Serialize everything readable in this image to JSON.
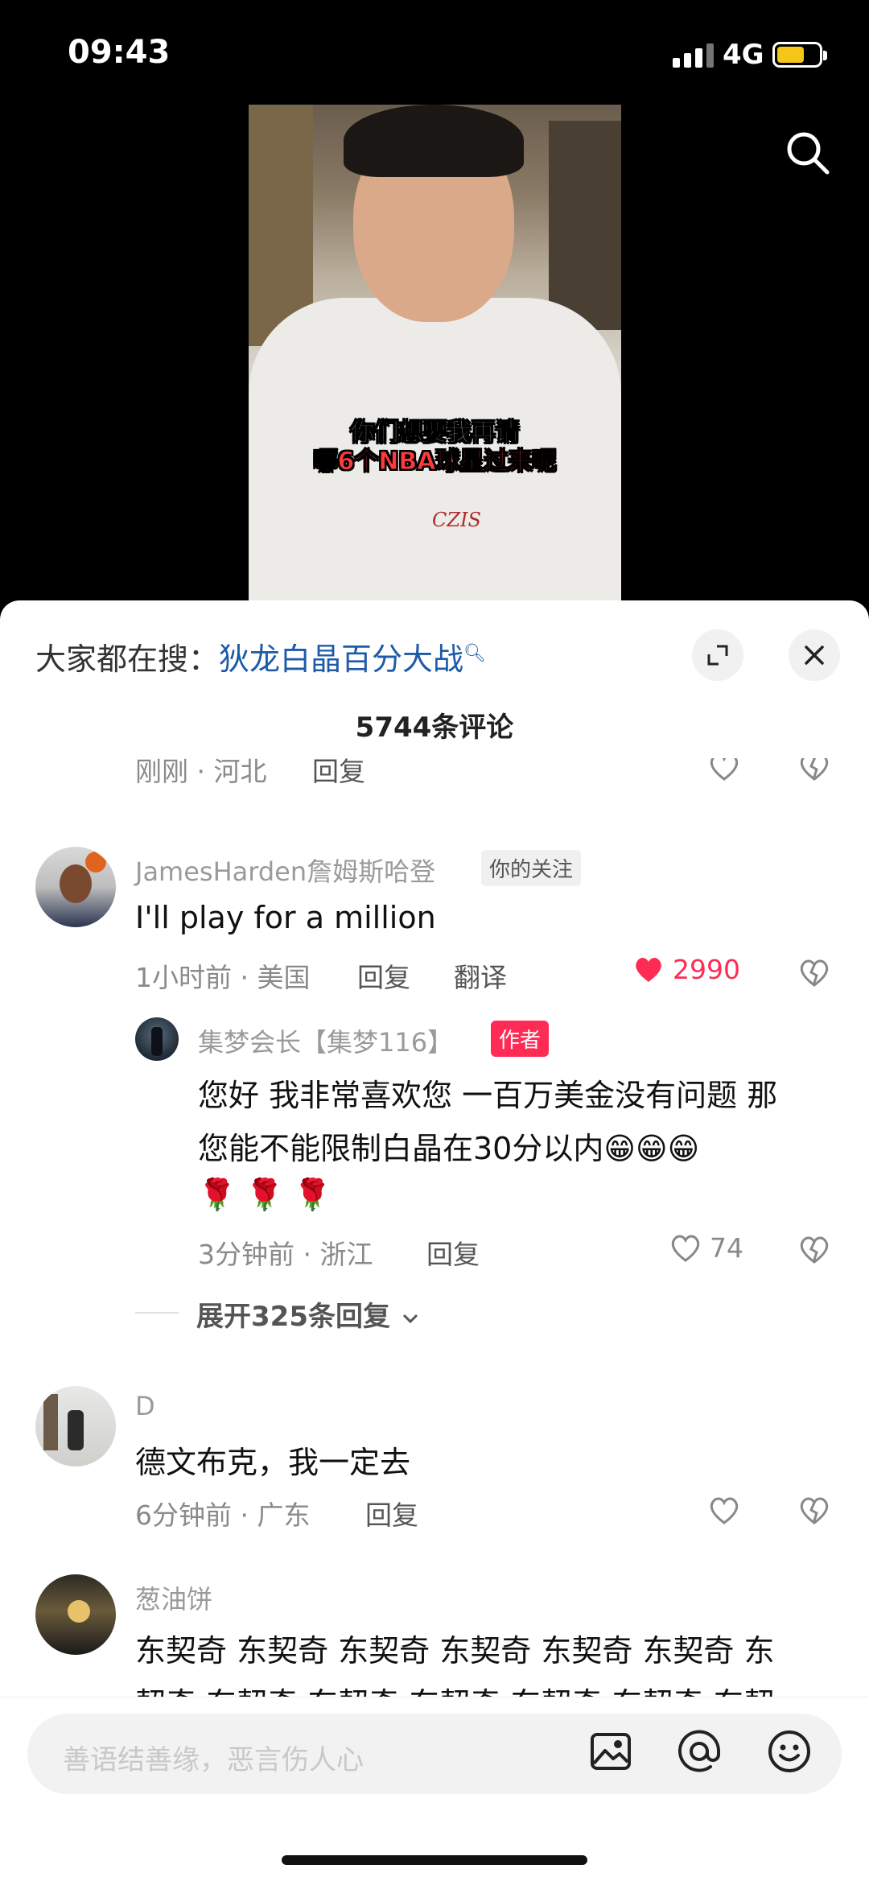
{
  "status": {
    "time": "09:43",
    "network": "4G"
  },
  "video": {
    "caption_line1": "你们想要我再请",
    "caption_line2": "哪6个NBA球星过来呢",
    "shirt_logo": "CZIS"
  },
  "sheet": {
    "hot_search_prefix": "大家都在搜：",
    "hot_search_keyword": "狄龙白晶百分大战",
    "comment_count": "5744条评论"
  },
  "previous": {
    "time_loc": "刚刚 · 河北",
    "reply": "回复"
  },
  "comments": [
    {
      "username": "JamesHarden詹姆斯哈登",
      "tag": "你的关注",
      "text": "I'll play for a million",
      "time_loc": "1小时前 · 美国",
      "reply": "回复",
      "translate": "翻译",
      "likes": "2990"
    },
    {
      "username": "D",
      "text": "德文布克，我一定去",
      "time_loc": "6分钟前 · 广东",
      "reply": "回复"
    },
    {
      "username": "葱油饼",
      "text_line1": "东契奇 东契奇 东契奇 东契奇 东契奇 东契奇 东",
      "text_line2": "契奇 东契奇 东契奇 东契奇 东契奇 东契奇 东契"
    }
  ],
  "reply": {
    "username": "集梦会长【集梦116】",
    "tag": "作者",
    "line1": "您好 我非常喜欢您 一百万美金没有问题 那",
    "line2": "您能不能限制白晶在30分以内😁😁😁",
    "line3": "🌹 🌹 🌹",
    "time_loc": "3分钟前 · 浙江",
    "reply": "回复",
    "likes": "74"
  },
  "expand_text": "展开325条回复",
  "input": {
    "placeholder": "善语结善缘，恶言伤人心"
  },
  "colors": {
    "accent": "#fe2c55",
    "link": "#1d5ba8",
    "author_tag": "#fe2c55"
  },
  "icons": [
    "search-icon",
    "fullscreen-icon",
    "close-icon",
    "heart-icon",
    "dislike-icon",
    "image-icon",
    "at-icon",
    "emoji-icon",
    "chevron-down-icon"
  ]
}
